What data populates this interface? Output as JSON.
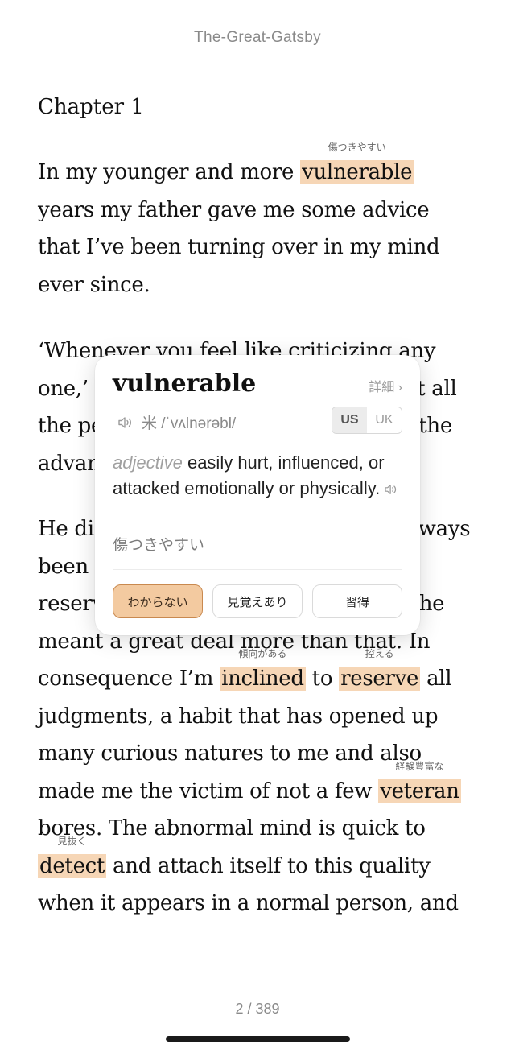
{
  "book_title": "The-Great-Gatsby",
  "chapter_title": "Chapter 1",
  "paragraph1": {
    "before": "In my younger and more ",
    "word": "vulnerable",
    "gloss": "傷つきやすい",
    "after": " years my father gave me some advice that I’ve been turning over in my mind ever since."
  },
  "paragraph2_text": "‘Whenever you feel like criticizing any one,’ he told me, ‘just remember that all the people in this world haven’t had the advantages that you’ve had.’",
  "paragraph3": {
    "part1": "He didn’t say any more, but we’ve always been unusually communicative in a reserved way, and I understood that he meant a great deal more than that. In consequence I’m ",
    "word1": "inclined",
    "gloss1": "傾向がある",
    "part2": " to ",
    "word2": "reserve",
    "gloss2": "控える",
    "part3": " all judgments, a habit that has opened up many curious natures to me and also made me the victim of not a few ",
    "word3": "veteran",
    "gloss3": "経験豊富な",
    "part4": " bores. The abnormal mind is quick to ",
    "word4": "detect",
    "gloss4": "見抜く",
    "part5": " and attach itself to this quality when it appears in a normal person, and"
  },
  "popup": {
    "word": "vulnerable",
    "detail_label": "詳細 ›",
    "phonetic": "米 /ˈvʌlnərəbl/",
    "region_us": "US",
    "region_uk": "UK",
    "part_of_speech": "adjective",
    "definition": " easily hurt, influenced, or attacked emotionally or physically.",
    "translation": "傷つきやすい",
    "btn_unknown": "わからない",
    "btn_familiar": "見覚えあり",
    "btn_mastered": "習得"
  },
  "page_indicator": "2 / 389",
  "colors": {
    "highlight": "#f6d6b6",
    "unknown_button": "#f3caa0"
  }
}
